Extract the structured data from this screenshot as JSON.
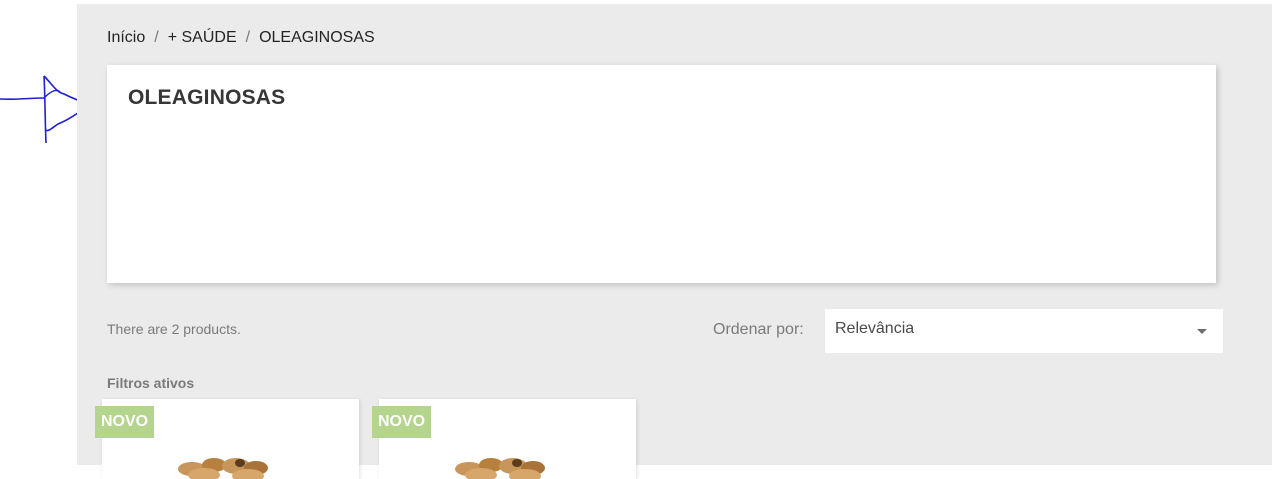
{
  "breadcrumb": {
    "items": [
      "Início",
      "+ SAÚDE",
      "OLEAGINOSAS"
    ],
    "separator": "/"
  },
  "category": {
    "title": "OLEAGINOSAS"
  },
  "listing": {
    "product_count_text": "There are 2 products.",
    "sort_label": "Ordenar por:",
    "sort_selected": "Relevância",
    "active_filters_label": "Filtros ativos"
  },
  "products": [
    {
      "badge": "NOVO",
      "image_icon": "nuts-image-icon"
    },
    {
      "badge": "NOVO",
      "image_icon": "nuts-image-icon"
    }
  ],
  "colors": {
    "page_background": "#ebebeb",
    "badge_new": "#b5d48d",
    "annotation_ink": "#1f1fd6"
  }
}
